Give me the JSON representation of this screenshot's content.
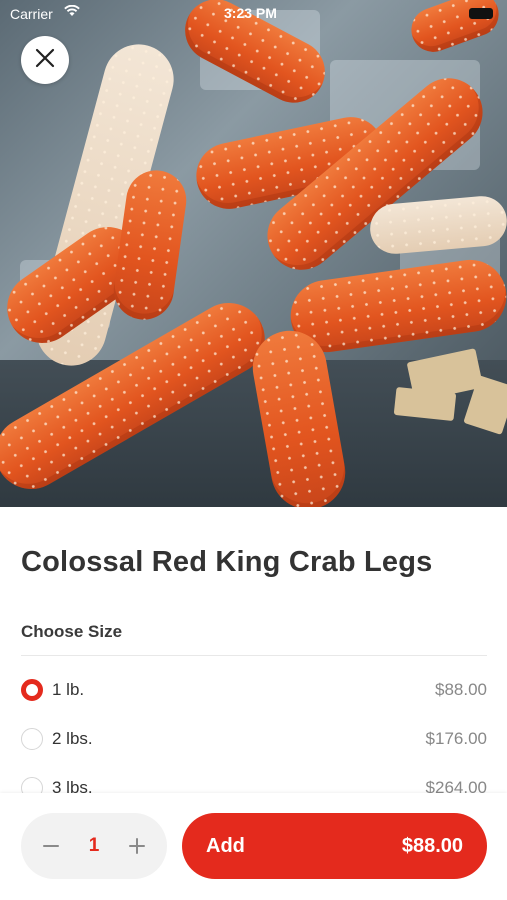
{
  "status_bar": {
    "carrier": "Carrier",
    "time": "3:23 PM"
  },
  "product": {
    "title": "Colossal Red King Crab Legs",
    "image_icon": "crab-legs-photo"
  },
  "size_section": {
    "label": "Choose Size",
    "options": [
      {
        "label": "1 lb.",
        "price": "$88.00",
        "selected": true
      },
      {
        "label": "2 lbs.",
        "price": "$176.00",
        "selected": false
      },
      {
        "label": "3 lbs.",
        "price": "$264.00",
        "selected": false
      }
    ]
  },
  "order_bar": {
    "quantity": "1",
    "decrement_icon": "minus-icon",
    "increment_icon": "plus-icon",
    "add_label": "Add",
    "add_price": "$88.00"
  },
  "colors": {
    "accent": "#e42a1d",
    "stepper_bg": "#f2f2f2",
    "price_gray": "#888888"
  }
}
